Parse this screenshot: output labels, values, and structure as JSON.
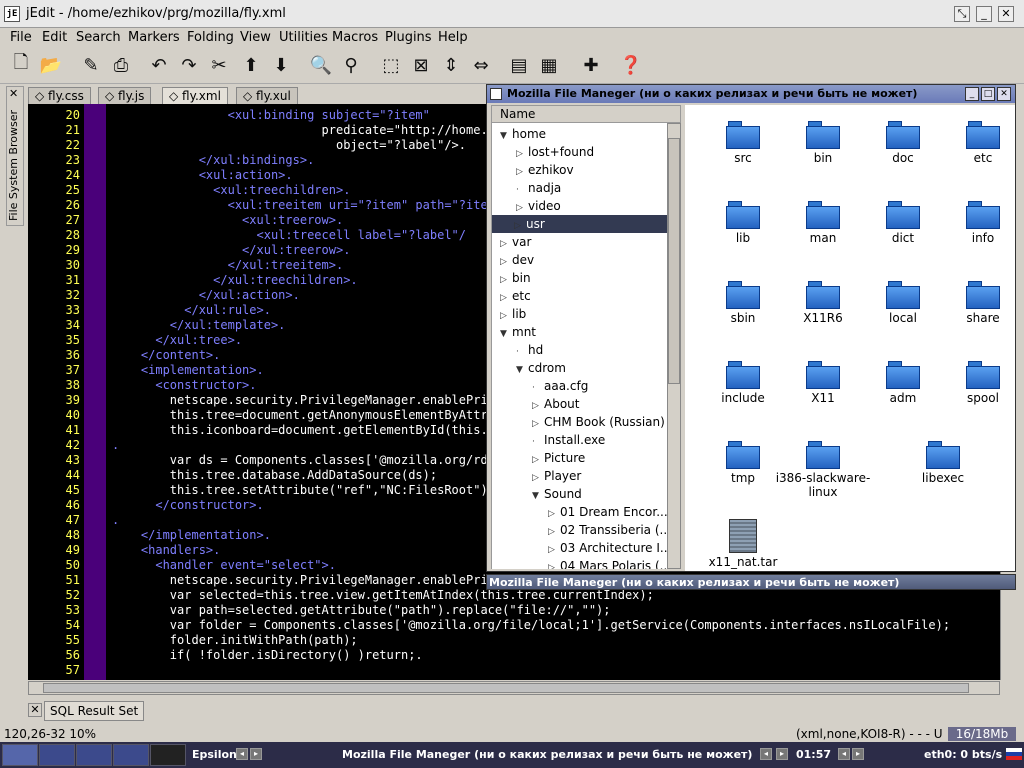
{
  "window": {
    "title": "jEdit - /home/ezhikov/prg/mozilla/fly.xml",
    "icon_text": "jE"
  },
  "menu": [
    "File",
    "Edit",
    "Search",
    "Markers",
    "Folding",
    "View",
    "Utilities",
    "Macros",
    "Plugins",
    "Help"
  ],
  "toolbar": [
    "new-file-icon",
    "open-icon",
    "pen-icon",
    "print-icon",
    "undo-icon",
    "redo-icon",
    "cut-icon",
    "upload-icon",
    "download-icon",
    "find-icon",
    "find-replace-icon",
    "select-icon",
    "expand-icon",
    "updown-icon",
    "leftright-icon",
    "bookmark-icon",
    "options-icon",
    "plugin-icon",
    "help-icon"
  ],
  "side_panel": {
    "label": "File System Browser",
    "close": "✕"
  },
  "buffers": [
    "fly.css",
    "fly.js",
    "fly.xml",
    "fly.xul"
  ],
  "active_buffer": "fly.xml",
  "editor": {
    "lines": [
      {
        "n": "20",
        "t": "                <xul:binding subject=\"?item\""
      },
      {
        "n": "21",
        "t": "                             predicate=\"http://home.nets"
      },
      {
        "n": "22",
        "t": "                               object=\"?label\"/>."
      },
      {
        "n": "23",
        "t": "            </xul:bindings>."
      },
      {
        "n": "24",
        "t": "            <xul:action>."
      },
      {
        "n": "25",
        "t": "              <xul:treechildren>."
      },
      {
        "n": "26",
        "t": "                <xul:treeitem uri=\"?item\" path=\"?item"
      },
      {
        "n": "27",
        "t": "                  <xul:treerow>."
      },
      {
        "n": "28",
        "t": "                    <xul:treecell label=\"?label\"/"
      },
      {
        "n": "29",
        "t": "                  </xul:treerow>."
      },
      {
        "n": "30",
        "t": "                </xul:treeitem>."
      },
      {
        "n": "31",
        "t": "              </xul:treechildren>."
      },
      {
        "n": "32",
        "t": "            </xul:action>."
      },
      {
        "n": "33",
        "t": "          </xul:rule>."
      },
      {
        "n": "34",
        "t": "        </xul:template>."
      },
      {
        "n": "35",
        "t": "      </xul:tree>."
      },
      {
        "n": "36",
        "t": "    </content>."
      },
      {
        "n": "37",
        "t": "    <implementation>."
      },
      {
        "n": "38",
        "t": "      <constructor>."
      },
      {
        "n": "39",
        "t": "        netscape.security.PrivilegeManager.enablePriv"
      },
      {
        "n": "40",
        "t": "        this.tree=document.getAnonymousElementByAttri"
      },
      {
        "n": "41",
        "t": "        this.iconboard=document.getElementById(this.ge"
      },
      {
        "n": "42",
        "t": "."
      },
      {
        "n": "43",
        "t": "        var ds = Components.classes['@mozilla.org/rdf/"
      },
      {
        "n": "44",
        "t": "        this.tree.database.AddDataSource(ds);"
      },
      {
        "n": "45",
        "t": "        this.tree.setAttribute(\"ref\",\"NC:FilesRoot\");"
      },
      {
        "n": "46",
        "t": "      </constructor>."
      },
      {
        "n": "47",
        "t": "."
      },
      {
        "n": "48",
        "t": "    </implementation>."
      },
      {
        "n": "49",
        "t": "    <handlers>."
      },
      {
        "n": "50",
        "t": "      <handler event=\"select\">."
      },
      {
        "n": "51",
        "t": "        netscape.security.PrivilegeManager.enablePriv"
      },
      {
        "n": "52",
        "t": "        var selected=this.tree.view.getItemAtIndex(this.tree.currentIndex);"
      },
      {
        "n": "53",
        "t": "        var path=selected.getAttribute(\"path\").replace(\"file://\",\"\");"
      },
      {
        "n": "54",
        "t": "        var folder = Components.classes['@mozilla.org/file/local;1'].getService(Components.interfaces.nsILocalFile);"
      },
      {
        "n": "55",
        "t": "        folder.initWithPath(path);"
      },
      {
        "n": "56",
        "t": "        if( !folder.isDirectory() )return;."
      },
      {
        "n": "57",
        "t": ""
      }
    ]
  },
  "bottom_panel": {
    "close": "✕",
    "tab": "SQL Result Set"
  },
  "status": {
    "position": "120,26-32 10%",
    "mode": "(xml,none,KOI8-R) - - - U",
    "memory": "16/18Mb"
  },
  "file_manager": {
    "title": "Mozilla File Maneger (ни о каких релизах и речи быть не может)",
    "tree_header": "Name",
    "tree": [
      {
        "label": "home",
        "level": 1,
        "arrow": "down"
      },
      {
        "label": "lost+found",
        "level": 2,
        "arrow": "right"
      },
      {
        "label": "ezhikov",
        "level": 2,
        "arrow": "right"
      },
      {
        "label": "nadja",
        "level": 2,
        "arrow": "none"
      },
      {
        "label": "video",
        "level": 2,
        "arrow": "right"
      },
      {
        "label": "usr",
        "level": 1,
        "arrow": "right",
        "selected": true
      },
      {
        "label": "var",
        "level": 1,
        "arrow": "right"
      },
      {
        "label": "dev",
        "level": 1,
        "arrow": "right"
      },
      {
        "label": "bin",
        "level": 1,
        "arrow": "right"
      },
      {
        "label": "etc",
        "level": 1,
        "arrow": "right"
      },
      {
        "label": "lib",
        "level": 1,
        "arrow": "right"
      },
      {
        "label": "mnt",
        "level": 1,
        "arrow": "down"
      },
      {
        "label": "hd",
        "level": 2,
        "arrow": "none"
      },
      {
        "label": "cdrom",
        "level": 2,
        "arrow": "down"
      },
      {
        "label": "aaa.cfg",
        "level": 3,
        "arrow": "none"
      },
      {
        "label": "About",
        "level": 3,
        "arrow": "right"
      },
      {
        "label": "CHM Book (Russian)",
        "level": 3,
        "arrow": "right"
      },
      {
        "label": "Install.exe",
        "level": 3,
        "arrow": "none"
      },
      {
        "label": "Picture",
        "level": 3,
        "arrow": "right"
      },
      {
        "label": "Player",
        "level": 3,
        "arrow": "right"
      },
      {
        "label": "Sound",
        "level": 3,
        "arrow": "down"
      },
      {
        "label": "01 Dream Encor...",
        "level": 4,
        "arrow": "right"
      },
      {
        "label": "02 Transsiberia (...",
        "level": 4,
        "arrow": "right"
      },
      {
        "label": "03 Architecture I...",
        "level": 4,
        "arrow": "right"
      },
      {
        "label": "04 Mars Polaris (...",
        "level": 4,
        "arrow": "right"
      }
    ],
    "icons": [
      "src",
      "bin",
      "doc",
      "etc",
      "lib",
      "man",
      "dict",
      "info",
      "sbin",
      "X11R6",
      "local",
      "share",
      "include",
      "X11",
      "adm",
      "spool",
      "tmp",
      "i386-slackware-linux",
      "libexec"
    ],
    "file": "x11_nat.tar",
    "second_title": "Mozilla File Maneger (ни о каких релизах и речи быть не может)"
  },
  "taskbar": {
    "workspace": "Epsilon",
    "task": "Mozilla File Maneger (ни о каких релизах и речи быть не может)",
    "clock": "01:57",
    "net": "eth0: 0 bts/s"
  }
}
